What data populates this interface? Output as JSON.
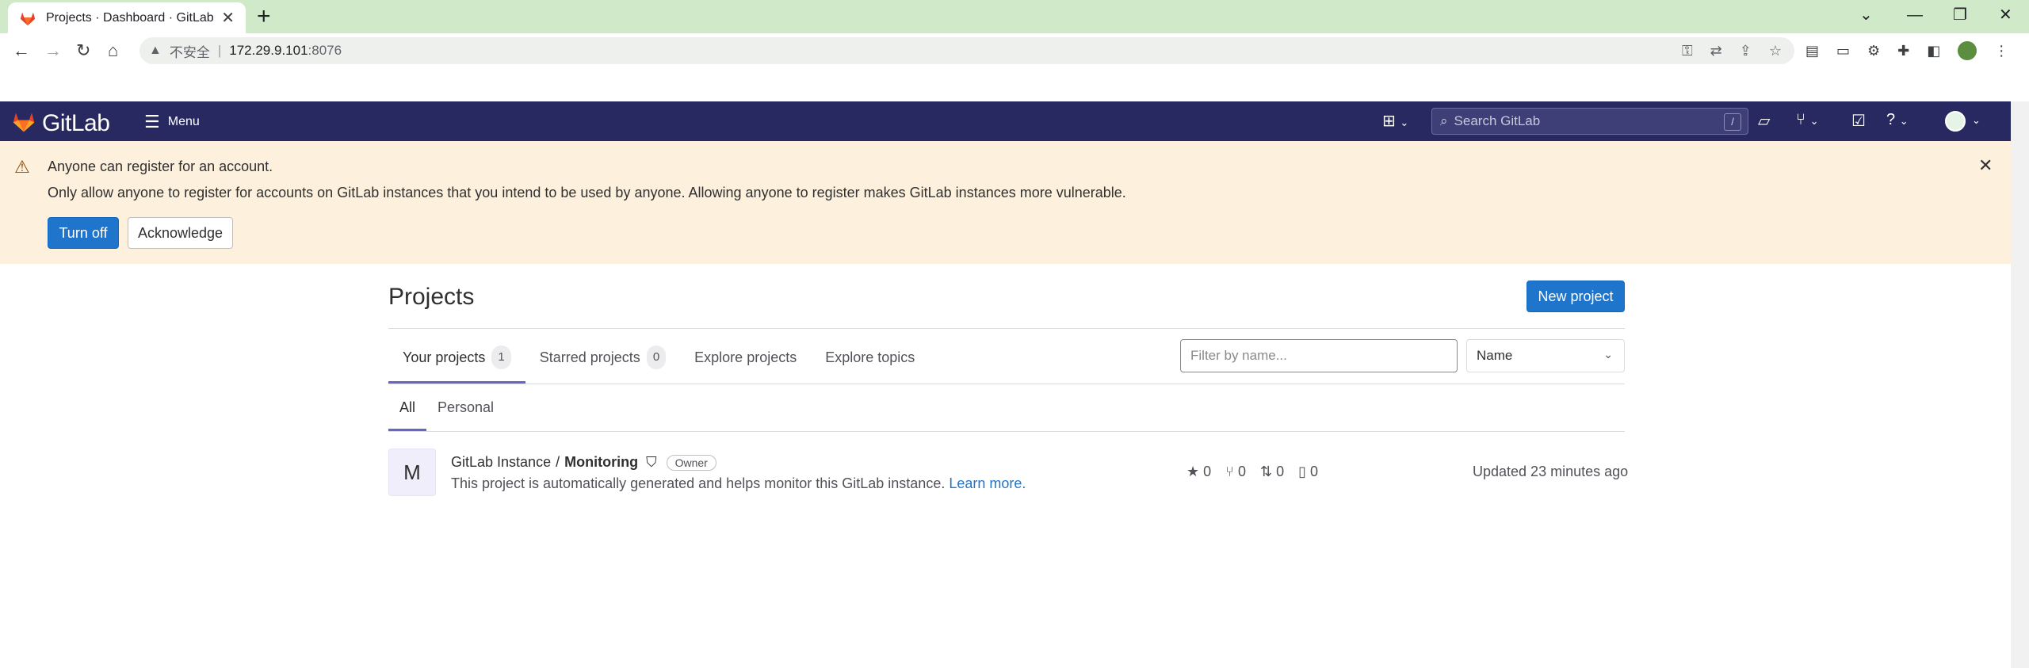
{
  "browser": {
    "tab_title": "Projects · Dashboard · GitLab",
    "insecure_label": "不安全",
    "url_host": "172.29.9.101",
    "url_port": ":8076"
  },
  "header": {
    "brand": "GitLab",
    "menu_label": "Menu",
    "search_placeholder": "Search GitLab",
    "search_shortcut": "/"
  },
  "banner": {
    "title": "Anyone can register for an account.",
    "body": "Only allow anyone to register for accounts on GitLab instances that you intend to be used by anyone. Allowing anyone to register makes GitLab instances more vulnerable.",
    "turn_off": "Turn off",
    "acknowledge": "Acknowledge"
  },
  "main": {
    "title": "Projects",
    "new_project": "New project",
    "tabs": [
      {
        "label": "Your projects",
        "count": "1"
      },
      {
        "label": "Starred projects",
        "count": "0"
      },
      {
        "label": "Explore projects"
      },
      {
        "label": "Explore topics"
      }
    ],
    "filter_placeholder": "Filter by name...",
    "sort_value": "Name",
    "subtabs": [
      {
        "label": "All"
      },
      {
        "label": "Personal"
      }
    ]
  },
  "projects": [
    {
      "avatar_letter": "M",
      "namespace": "GitLab Instance",
      "name": "Monitoring",
      "role": "Owner",
      "description": "This project is automatically generated and helps monitor this GitLab instance.",
      "learn_more": "Learn more.",
      "stars": "0",
      "forks": "0",
      "merge_requests": "0",
      "issues": "0",
      "updated": "Updated 23 minutes ago"
    }
  ],
  "colors": {
    "header_bg": "#292961",
    "banner_bg": "#fdf1dd",
    "primary": "#1f75cb",
    "tab_strip": "#cfe9c9"
  }
}
